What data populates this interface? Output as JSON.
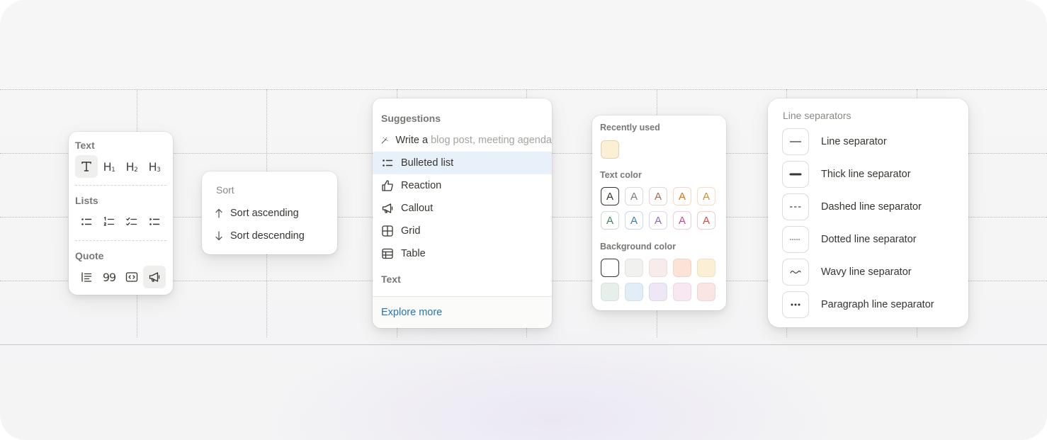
{
  "text_toolbar": {
    "text_heading": "Text",
    "lists_heading": "Lists",
    "quote_heading": "Quote",
    "h1_main": "H",
    "h1_sub": "1",
    "h2_main": "H",
    "h2_sub": "2",
    "h3_main": "H",
    "h3_sub": "3",
    "icons": [
      "text-icon",
      "heading-1-icon",
      "heading-2-icon",
      "heading-3-icon",
      "bulleted-list-icon",
      "numbered-list-icon",
      "todo-list-icon",
      "toggle-list-icon",
      "quote-icon",
      "blockquote-99-icon",
      "code-icon",
      "callout-megaphone-icon"
    ]
  },
  "sort_menu": {
    "heading": "Sort",
    "items": [
      {
        "label": "Sort ascending",
        "icon": "arrow-up-icon"
      },
      {
        "label": "Sort descending",
        "icon": "arrow-down-icon"
      }
    ]
  },
  "suggestions_menu": {
    "heading": "Suggestions",
    "ai_prefix": "Write a",
    "ai_placeholder": "blog post, meeting agenda",
    "items": [
      {
        "label": "Bulleted list",
        "icon": "bulleted-list-icon",
        "highlighted": true
      },
      {
        "label": "Reaction",
        "icon": "thumbs-up-icon"
      },
      {
        "label": "Callout",
        "icon": "megaphone-icon"
      },
      {
        "label": "Grid",
        "icon": "grid-icon"
      },
      {
        "label": "Table",
        "icon": "table-icon"
      }
    ],
    "text_heading": "Text",
    "footer_link": "Explore more",
    "highlight_color": "#e8f1f9",
    "link_color": "#2274b8"
  },
  "color_picker": {
    "recent_heading": "Recently used",
    "text_heading": "Text color",
    "background_heading": "Background color",
    "swatch_letter": "A",
    "recent_colors": [
      "#fbf0d6"
    ],
    "text_colors": [
      "#37352f",
      "#7d7a75",
      "#9f6b53",
      "#d9730d",
      "#cb912f",
      "#448361",
      "#337ea9",
      "#9065b0",
      "#c14c8a",
      "#d44c47"
    ],
    "background_colors": [
      "#ffffff",
      "#f1f1ef",
      "#f8ecea",
      "#fbe4d5",
      "#fbf0d6",
      "#e6f0ea",
      "#e1eef8",
      "#efe6f6",
      "#f8e8f1",
      "#fbe5e4"
    ]
  },
  "line_separators": {
    "heading": "Line separators",
    "items": [
      {
        "label": "Line separator",
        "icon": "line-separator-icon"
      },
      {
        "label": "Thick line separator",
        "icon": "thick-line-separator-icon"
      },
      {
        "label": "Dashed line separator",
        "icon": "dashed-line-separator-icon"
      },
      {
        "label": "Dotted line separator",
        "icon": "dotted-line-separator-icon"
      },
      {
        "label": "Wavy line separator",
        "icon": "wavy-line-separator-icon"
      },
      {
        "label": "Paragraph line separator",
        "icon": "paragraph-separator-icon"
      }
    ]
  }
}
